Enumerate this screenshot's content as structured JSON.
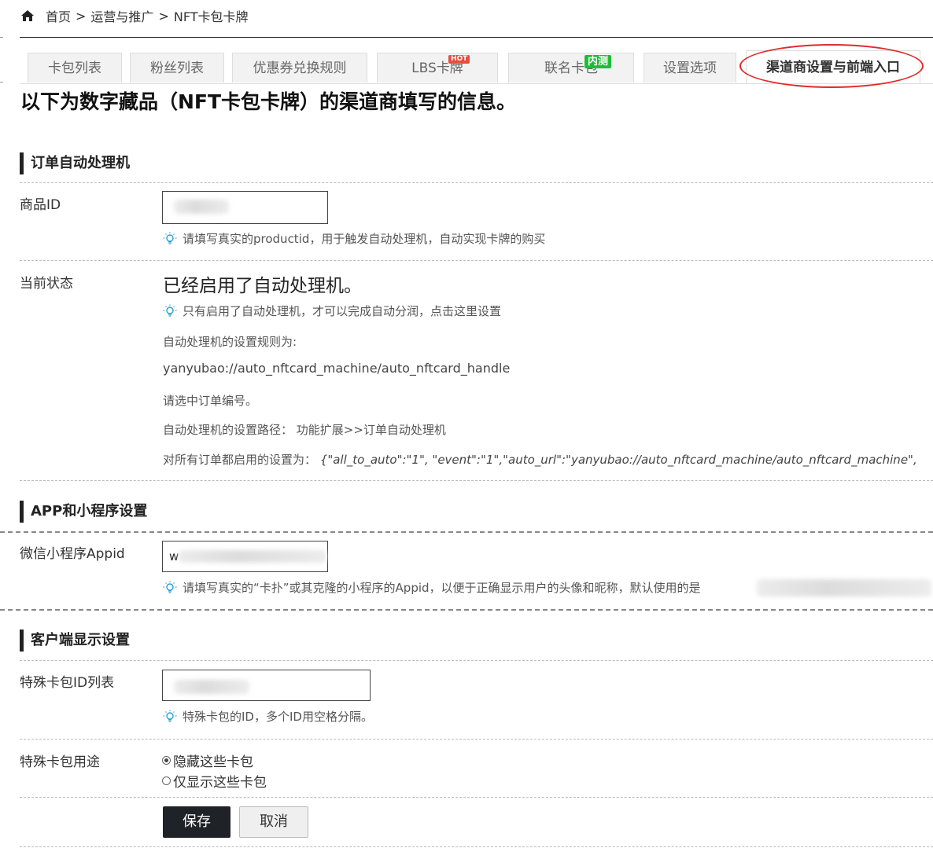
{
  "breadcrumb": {
    "home": "首页",
    "section": "运营与推广",
    "current": "NFT卡包卡牌",
    "sep": ">"
  },
  "tabs": [
    {
      "label": "卡包列表"
    },
    {
      "label": "粉丝列表"
    },
    {
      "label": "优惠券兑换规则"
    },
    {
      "label": "LBS卡牌",
      "badge": "HOT"
    },
    {
      "label": "联名卡包",
      "badge": "内测"
    },
    {
      "label": "设置选项"
    },
    {
      "label": "渠道商设置与前端入口",
      "active": true
    }
  ],
  "page_heading": "以下为数字藏品（NFT卡包卡牌）的渠道商填写的信息。",
  "order_section": {
    "title": "订单自动处理机",
    "product_id_label": "商品ID",
    "product_id_hint": "请填写真实的productid，用于触发自动处理机，自动实现卡牌的购买",
    "status_label": "当前状态",
    "status_text": "已经启用了自动处理机。",
    "status_hint": "只有启用了自动处理机，才可以完成自动分润，点击这里设置",
    "rule_label": "自动处理机的设置规则为:",
    "rule_path": "yanyubao://auto_nftcard_machine/auto_nftcard_handle",
    "select_order": "请选中订单编号。",
    "setting_path_label": "自动处理机的设置路径：",
    "setting_path_value": "功能扩展>>订单自动处理机",
    "all_orders_label": "对所有订单都启用的设置为：",
    "all_orders_value": "{\"all_to_auto\":\"1\", \"event\":\"1\",\"auto_url\":\"yanyubao://auto_nftcard_machine/auto_nftcard_machine\","
  },
  "app_section": {
    "title": "APP和小程序设置",
    "appid_label": "微信小程序Appid",
    "appid_prefix": "w",
    "appid_hint": "请填写真实的“卡扑”或其克隆的小程序的Appid，以便于正确显示用户的头像和昵称，默认使用的是"
  },
  "client_section": {
    "title": "客户端显示设置",
    "special_ids_label": "特殊卡包ID列表",
    "special_ids_hint": "特殊卡包的ID，多个ID用空格分隔。",
    "usage_label": "特殊卡包用途",
    "options": [
      {
        "label": "隐藏这些卡包",
        "selected": true
      },
      {
        "label": "仅显示这些卡包",
        "selected": false
      }
    ]
  },
  "buttons": {
    "save": "保存",
    "cancel": "取消"
  },
  "icons": {
    "home": "home-icon",
    "hint": "lightbulb-icon"
  },
  "colors": {
    "accent_dark": "#1f2327",
    "highlight_ellipse": "#e02a2a",
    "hot_badge": "#e74c3c",
    "beta_badge": "#1fbd35"
  }
}
